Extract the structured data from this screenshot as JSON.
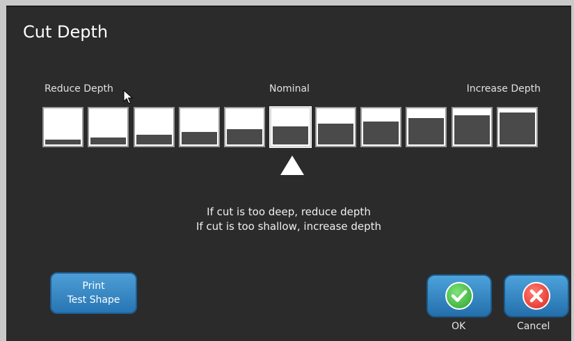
{
  "dialog": {
    "title": "Cut Depth",
    "label_reduce": "Reduce Depth",
    "label_nominal": "Nominal",
    "label_increase": "Increase Depth",
    "depth_levels": [
      {
        "fill": 0.13
      },
      {
        "fill": 0.19
      },
      {
        "fill": 0.26
      },
      {
        "fill": 0.33
      },
      {
        "fill": 0.41
      },
      {
        "fill": 0.48
      },
      {
        "fill": 0.55
      },
      {
        "fill": 0.62
      },
      {
        "fill": 0.7
      },
      {
        "fill": 0.77
      },
      {
        "fill": 0.85
      }
    ],
    "selected_index": 5,
    "instruction_1": "If cut is too deep, reduce depth",
    "instruction_2": "If cut is too shallow, increase depth"
  },
  "buttons": {
    "print_line1": "Print",
    "print_line2": "Test Shape",
    "ok_label": "OK",
    "cancel_label": "Cancel"
  },
  "icons": {
    "ok": "checkmark-icon",
    "cancel": "x-icon",
    "marker": "triangle-up-icon",
    "cursor": "mouse-pointer-icon"
  },
  "colors": {
    "background": "#2b2b2b",
    "accent_blue": "#2f80c0",
    "ok_green": "#3cb83a",
    "cancel_red": "#e8352c"
  }
}
